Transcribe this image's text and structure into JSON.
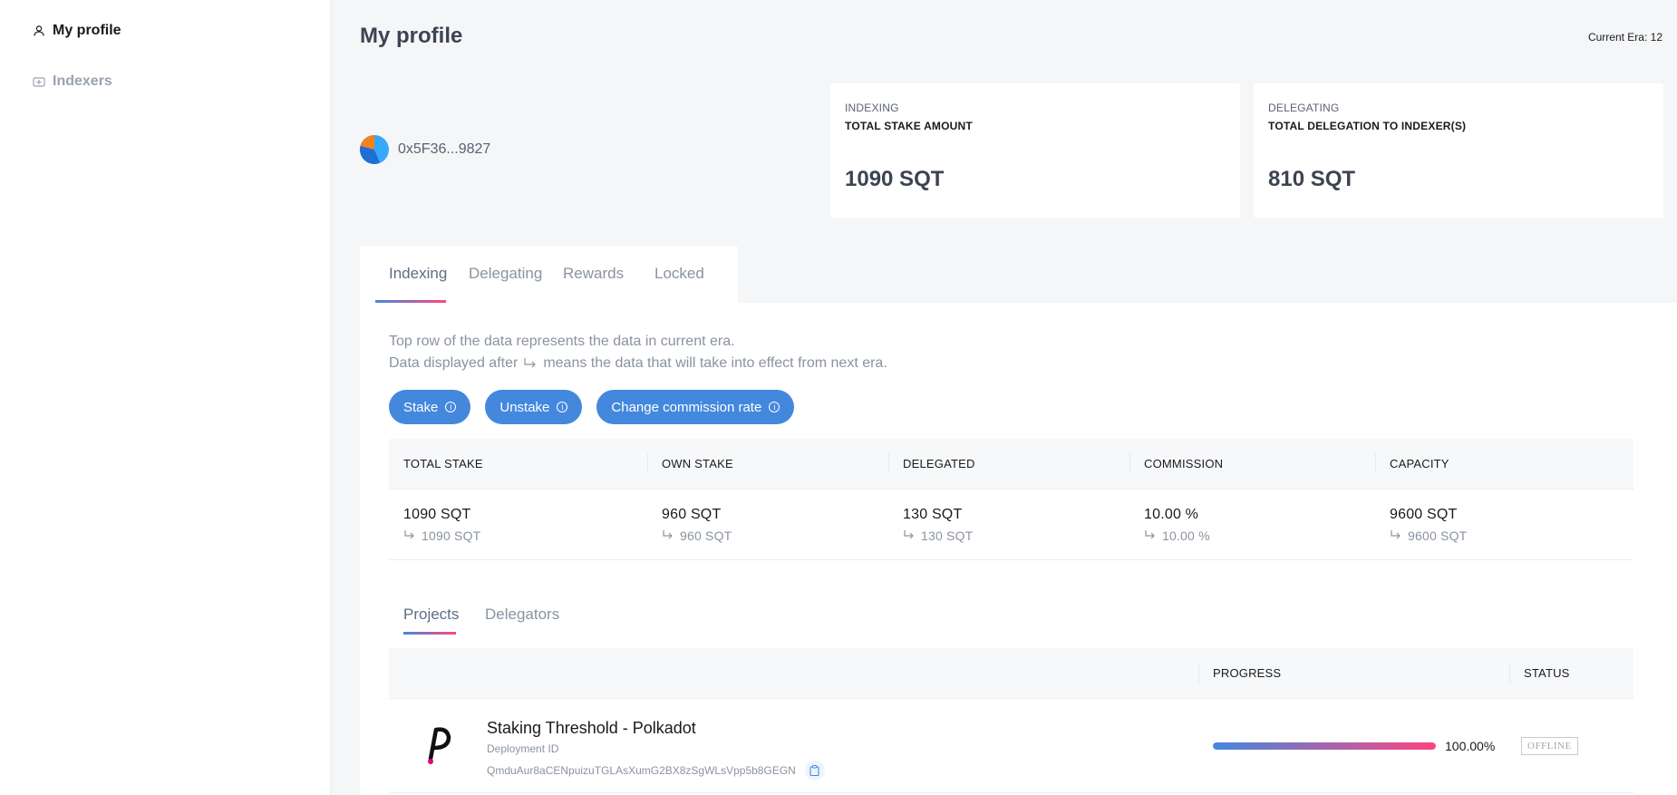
{
  "sidebar": {
    "items": [
      {
        "label": "My profile",
        "icon": "user-icon",
        "active": true
      },
      {
        "label": "Indexers",
        "icon": "indexer-icon",
        "active": false
      }
    ]
  },
  "header": {
    "title": "My profile",
    "current_era": "Current Era: 12"
  },
  "account": {
    "address": "0x5F36...9827",
    "avatar_colors": [
      "#f5821f",
      "#1f6fd6",
      "#36a9ff"
    ]
  },
  "stats": [
    {
      "overline": "INDEXING",
      "label": "TOTAL STAKE AMOUNT",
      "value": "1090 SQT"
    },
    {
      "overline": "DELEGATING",
      "label": "TOTAL DELEGATION TO INDEXER(S)",
      "value": "810 SQT"
    }
  ],
  "tabs": [
    {
      "label": "Indexing",
      "active": true
    },
    {
      "label": "Delegating",
      "active": false
    },
    {
      "label": "Rewards",
      "active": false
    },
    {
      "label": "Locked",
      "active": false
    }
  ],
  "description": {
    "line1": "Top row of the data represents the data in current era.",
    "line2_prefix": "Data displayed after",
    "line2_suffix": "means the data that will take into effect from next era."
  },
  "buttons": {
    "stake": "Stake",
    "unstake": "Unstake",
    "change_commission": "Change commission rate"
  },
  "stake_table": {
    "headers": [
      "TOTAL STAKE",
      "OWN STAKE",
      "DELEGATED",
      "COMMISSION",
      "CAPACITY"
    ],
    "current": [
      "1090 SQT",
      "960 SQT",
      "130 SQT",
      "10.00 %",
      "9600 SQT"
    ],
    "next": [
      "1090 SQT",
      "960 SQT",
      "130 SQT",
      "10.00 %",
      "9600 SQT"
    ]
  },
  "sub_tabs": [
    {
      "label": "Projects",
      "active": true
    },
    {
      "label": "Delegators",
      "active": false
    }
  ],
  "projects_table": {
    "headers": {
      "progress": "PROGRESS",
      "status": "STATUS"
    },
    "rows": [
      {
        "name": "Staking Threshold - Polkadot",
        "deployment_label": "Deployment ID",
        "deployment_id": "QmduAur8aCENpuizuTGLAsXumG2BX8zSgWLsVpp5b8GEGN",
        "progress": 100,
        "progress_text": "100.00%",
        "status": "OFFLINE",
        "logo": "polkadot-logo"
      }
    ]
  },
  "colors": {
    "primary": "#4388dd",
    "gradient_end": "#ff4581",
    "title": "#3c4452"
  }
}
